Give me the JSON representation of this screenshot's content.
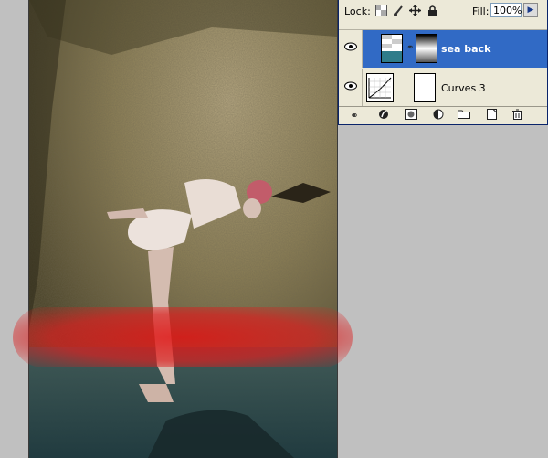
{
  "layers_panel": {
    "lock_label": "Lock:",
    "fill_label": "Fill:",
    "fill_value": "100%",
    "layers": [
      {
        "name": "sea back",
        "selected": true
      },
      {
        "name": "Curves 3",
        "selected": false
      }
    ]
  },
  "icons": {
    "lock": [
      "lock-transparent-icon",
      "lock-paint-icon",
      "lock-move-icon",
      "lock-all-icon"
    ],
    "footer": [
      "link-layers-icon",
      "layer-style-icon",
      "add-mask-icon",
      "adjustment-layer-icon",
      "new-group-icon",
      "new-layer-icon",
      "delete-layer-icon"
    ]
  },
  "colors": {
    "selection": "#316ac5",
    "panel_bg": "#ece9d8",
    "workspace": "#c0c0c0",
    "red_highlight": "#e01414"
  }
}
